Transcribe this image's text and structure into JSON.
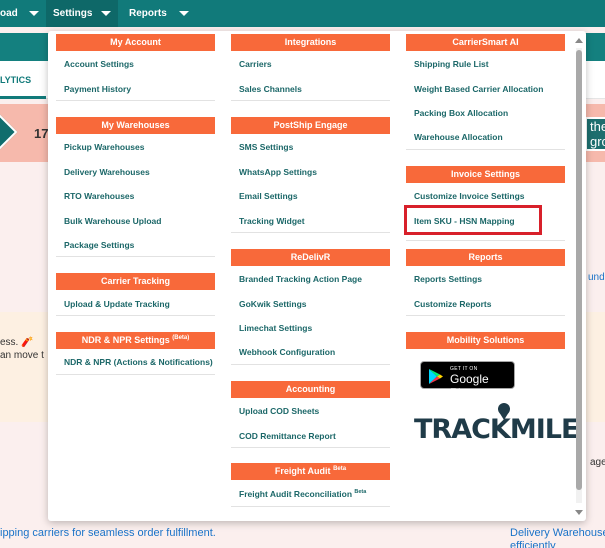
{
  "nav": {
    "items": [
      {
        "label": "oad"
      },
      {
        "label": "Settings"
      },
      {
        "label": "Reports"
      }
    ]
  },
  "background": {
    "tab_label": "LYTICS",
    "banner_number": "17",
    "banner_pill_text": "the gro",
    "side_link_text": "und",
    "notice_line1": "ess. 🧨",
    "notice_line2": "an move t",
    "right_text": "age",
    "footer_left": "ipping carriers for seamless order fulfillment.",
    "footer_right_1": "Delivery Warehouse",
    "footer_right_2": "efficiently"
  },
  "menu": {
    "col1": {
      "sections": [
        {
          "title": "My Account",
          "items": [
            "Account Settings",
            "Payment History"
          ]
        },
        {
          "title": "My Warehouses",
          "items": [
            "Pickup Warehouses",
            "Delivery Warehouses",
            "RTO Warehouses",
            "Bulk Warehouse Upload",
            "Package Settings"
          ]
        },
        {
          "title": "Carrier Tracking",
          "items": [
            "Upload & Update Tracking"
          ]
        },
        {
          "title": "NDR & NPR Settings",
          "title_sup": "(Beta)",
          "items": [
            "NDR & NPR (Actions & Notifications)"
          ]
        }
      ]
    },
    "col2": {
      "sections": [
        {
          "title": "Integrations",
          "items": [
            "Carriers",
            "Sales Channels"
          ]
        },
        {
          "title": "PostShip Engage",
          "items": [
            "SMS Settings",
            "WhatsApp Settings",
            "Email Settings",
            "Tracking Widget"
          ]
        },
        {
          "title": "ReDelivR",
          "items": [
            "Branded Tracking Action Page",
            "GoKwik Settings",
            "Limechat Settings",
            "Webhook Configuration"
          ]
        },
        {
          "title": "Accounting",
          "items": [
            "Upload COD Sheets",
            "COD Remittance Report"
          ]
        },
        {
          "title": "Freight Audit",
          "title_sup": "Beta",
          "items": [
            "Freight Audit Reconciliation"
          ],
          "item_sup": "Beta"
        }
      ]
    },
    "col3": {
      "sections": [
        {
          "title": "CarrierSmart AI",
          "items": [
            "Shipping Rule List",
            "Weight Based Carrier Allocation",
            "Packing Box Allocation",
            "Warehouse Allocation"
          ]
        },
        {
          "title": "Invoice Settings",
          "items": [
            "Customize Invoice Settings",
            "Item SKU - HSN Mapping"
          ]
        },
        {
          "title": "Reports",
          "items": [
            "Reports Settings",
            "Customize Reports"
          ]
        },
        {
          "title": "Mobility Solutions",
          "items": []
        }
      ]
    },
    "google_play": {
      "small": "GET IT ON",
      "big": "Google Play"
    },
    "trackmile_logo": "TRACKMILE"
  },
  "colors": {
    "nav_bg": "#117a7a",
    "section_header": "#f8693a",
    "item_text": "#1b6768",
    "highlight_border": "#d8202a"
  }
}
